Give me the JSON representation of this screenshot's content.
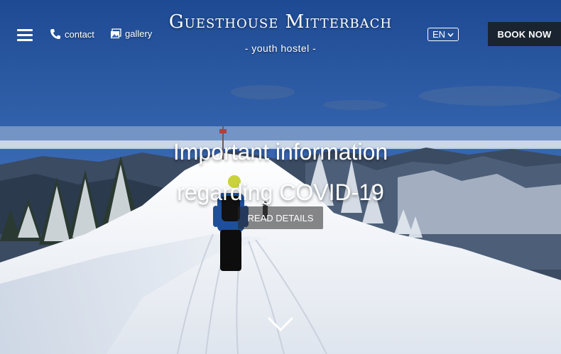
{
  "header": {
    "menu_icon": "hamburger-icon",
    "contact": {
      "icon": "phone-icon",
      "label": "contact"
    },
    "gallery": {
      "icon": "gallery-icon",
      "label": "gallery"
    },
    "brand_title": "Guesthouse Mitterbach",
    "brand_subtitle": "- youth hostel -",
    "language": "EN",
    "book_label": "BOOK NOW"
  },
  "hero": {
    "heading_line1": "Important information",
    "heading_line2": "regarding COVID-19",
    "details_label": "READ DETAILS",
    "scroll_icon": "chevron-down-icon"
  },
  "colors": {
    "book_button_bg": "#1a2431",
    "sky_top": "#1f4d96",
    "snow": "#f2f4f8"
  }
}
